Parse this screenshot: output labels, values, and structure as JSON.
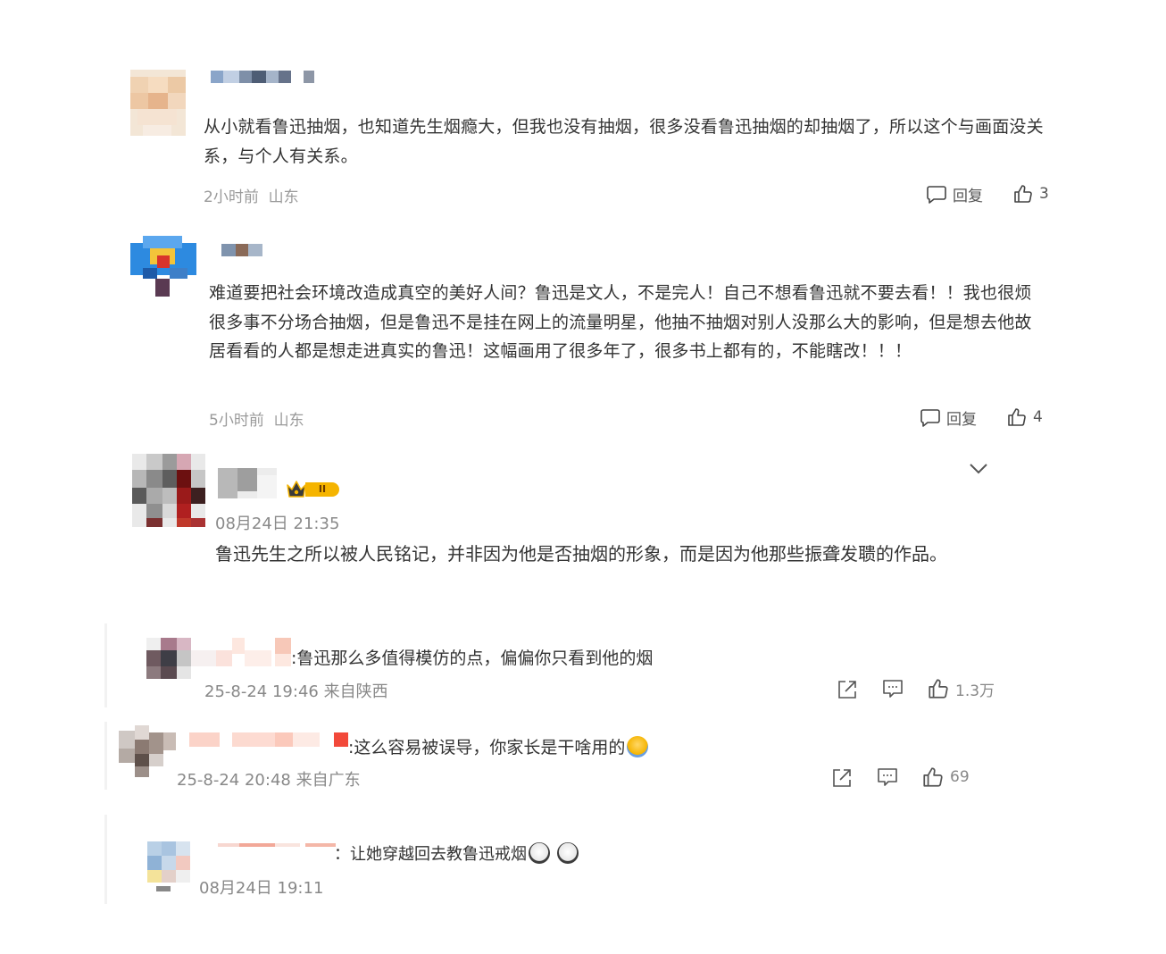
{
  "comments": [
    {
      "text": "从小就看鲁迅抽烟，也知道先生烟瘾大，但我也没有抽烟，很多没看鲁迅抽烟的却抽烟了，所以这个与画面没关系，与个人有关系。",
      "time": "2小时前",
      "location": "山东",
      "reply_label": "回复",
      "likes": "3"
    },
    {
      "text": "难道要把社会环境改造成真空的美好人间？鲁迅是文人，不是完人！自己不想看鲁迅就不要去看！！我也很烦很多事不分场合抽烟，但是鲁迅不是挂在网上的流量明星，他抽不抽烟对别人没那么大的影响，但是想去他故居看看的人都是想走进真实的鲁迅！这幅画用了很多年了，很多书上都有的，不能瞎改！！！",
      "time": "5小时前",
      "location": "山东",
      "reply_label": "回复",
      "likes": "4"
    }
  ],
  "post": {
    "badge": "II",
    "date": "08月24日 21:35",
    "text": "鲁迅先生之所以被人民铭记，并非因为他是否抽烟的形象，而是因为他那些振聋发聩的作品。"
  },
  "replies": [
    {
      "text": ":鲁迅那么多值得模仿的点，偏偏你只看到他的烟",
      "meta": "25-8-24 19:46 来自陕西",
      "likes": "1.3万"
    },
    {
      "text": ":这么容易被误导，你家长是干啥用的",
      "meta": "25-8-24 20:48 来自广东",
      "likes": "69"
    },
    {
      "text": "：让她穿越回去教鲁迅戒烟",
      "date": "08月24日 19:11"
    }
  ],
  "colors": {
    "text": "#333333",
    "meta": "#9a9a9a",
    "reply_bar": "#f2f2f2",
    "vip_gold": "#f5b400"
  },
  "icons": [
    "chat-bubble-icon",
    "thumbs-up-icon",
    "share-icon",
    "comment-icon",
    "chevron-down-icon",
    "crown-icon"
  ]
}
